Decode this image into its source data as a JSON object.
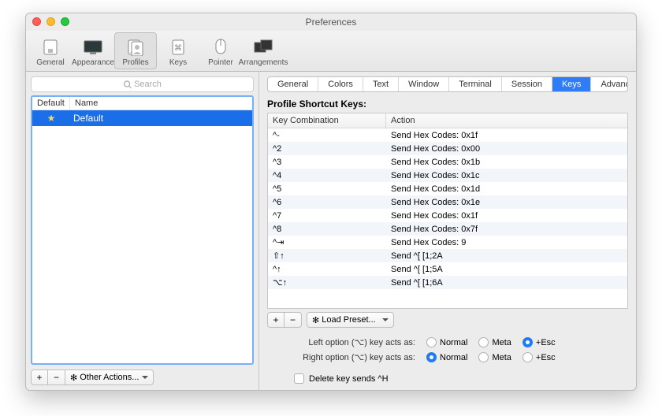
{
  "window": {
    "title": "Preferences"
  },
  "toolbar": [
    {
      "id": "general",
      "label": "General"
    },
    {
      "id": "appearance",
      "label": "Appearance"
    },
    {
      "id": "profiles",
      "label": "Profiles"
    },
    {
      "id": "keys",
      "label": "Keys"
    },
    {
      "id": "pointer",
      "label": "Pointer"
    },
    {
      "id": "arrangements",
      "label": "Arrangements"
    }
  ],
  "toolbar_selected": "profiles",
  "search": {
    "placeholder": "Search"
  },
  "profile_headers": {
    "col1": "Default",
    "col2": "Name"
  },
  "profiles": [
    {
      "starred": true,
      "name": "Default",
      "selected": true
    }
  ],
  "other_actions_label": "Other Actions...",
  "tabs": [
    "General",
    "Colors",
    "Text",
    "Window",
    "Terminal",
    "Session",
    "Keys",
    "Advanced"
  ],
  "tab_selected": "Keys",
  "section_title": "Profile Shortcut Keys:",
  "key_headers": {
    "combo": "Key Combination",
    "action": "Action"
  },
  "key_rows": [
    {
      "combo": "^-",
      "action": "Send Hex Codes: 0x1f"
    },
    {
      "combo": "^2",
      "action": "Send Hex Codes: 0x00"
    },
    {
      "combo": "^3",
      "action": "Send Hex Codes: 0x1b"
    },
    {
      "combo": "^4",
      "action": "Send Hex Codes: 0x1c"
    },
    {
      "combo": "^5",
      "action": "Send Hex Codes: 0x1d"
    },
    {
      "combo": "^6",
      "action": "Send Hex Codes: 0x1e"
    },
    {
      "combo": "^7",
      "action": "Send Hex Codes: 0x1f"
    },
    {
      "combo": "^8",
      "action": "Send Hex Codes: 0x7f"
    },
    {
      "combo": "^⇥",
      "action": "Send Hex Codes: 9"
    },
    {
      "combo": "⇧↑",
      "action": "Send ^[ [1;2A"
    },
    {
      "combo": "^↑",
      "action": "Send ^[ [1;5A"
    },
    {
      "combo": "⌥↑",
      "action": "Send ^[ [1;6A"
    }
  ],
  "load_preset_label": "Load Preset...",
  "option_question": {
    "left": "Left option (⌥) key acts as:",
    "right": "Right option (⌥) key acts as:"
  },
  "option_choices": [
    "Normal",
    "Meta",
    "+Esc"
  ],
  "option_left_selected": "+Esc",
  "option_right_selected": "Normal",
  "delete_label": "Delete key sends ^H",
  "delete_checked": false,
  "gear_glyph": "✻"
}
